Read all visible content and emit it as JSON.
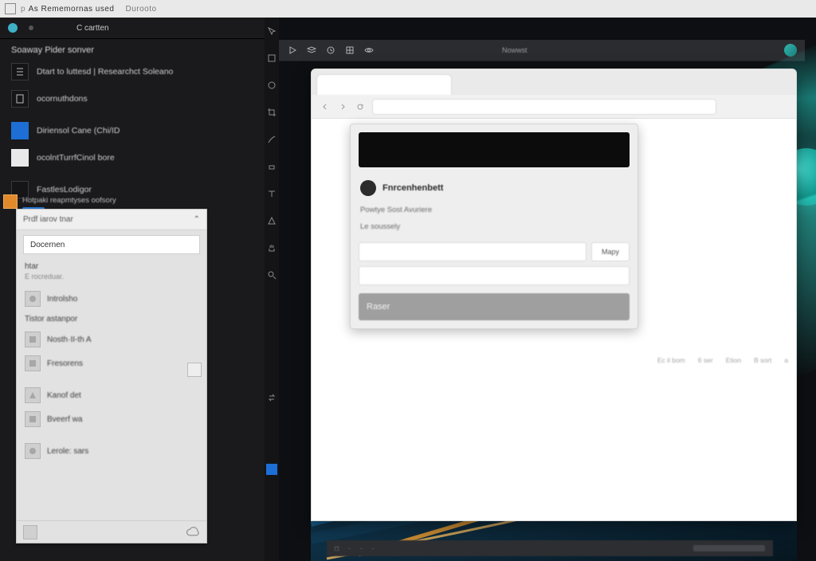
{
  "titlebar": {
    "app_name": "As   Rememornas used",
    "secondary": "Durooto"
  },
  "leftpanel": {
    "tab_label": "C cartten",
    "section_title": "Soaway Pider sonver",
    "items": [
      {
        "label": "Dtart to luttesd | Researchct Soleano"
      },
      {
        "label": "ocornuthdons"
      },
      "—",
      {
        "label": "Diriensol Cane (Chi/ID"
      },
      {
        "label": "ocolntTurrfCinol bore"
      },
      "—",
      {
        "label": "FastlesLodigor"
      }
    ],
    "sub_header": "Hotpaki reapmtyses oofsory"
  },
  "proppanel": {
    "header": "Prdf iarov tnar",
    "collapse_glyph": "⌃",
    "search": "Docernen",
    "group": "htar",
    "subtle": "E rocreduar.",
    "rows": [
      "Introlsho",
      "Tistor astanpor",
      "Nosth·II-th A",
      "Fresorens",
      "Kanof det",
      "Bveerf wa",
      "Lerole: sars"
    ]
  },
  "canvas_toolbar": {
    "doc_label": "Nowwst"
  },
  "floatwin": {
    "tab": "  ",
    "address": "  ",
    "dialog": {
      "username": "Fnrcenhenbett",
      "line1": "Powtye Sost Avuriere",
      "label_left": "Le  soussely",
      "input_placeholder": "",
      "input_btn": "Mapy",
      "input_placeholder_2": "",
      "big_button": "Raser"
    },
    "meta": [
      "Ec il bom",
      "6 ser",
      "Etion",
      "B sort",
      "a"
    ]
  },
  "canvas_status": {
    "items": [
      "□",
      "·",
      "·",
      "·"
    ]
  }
}
